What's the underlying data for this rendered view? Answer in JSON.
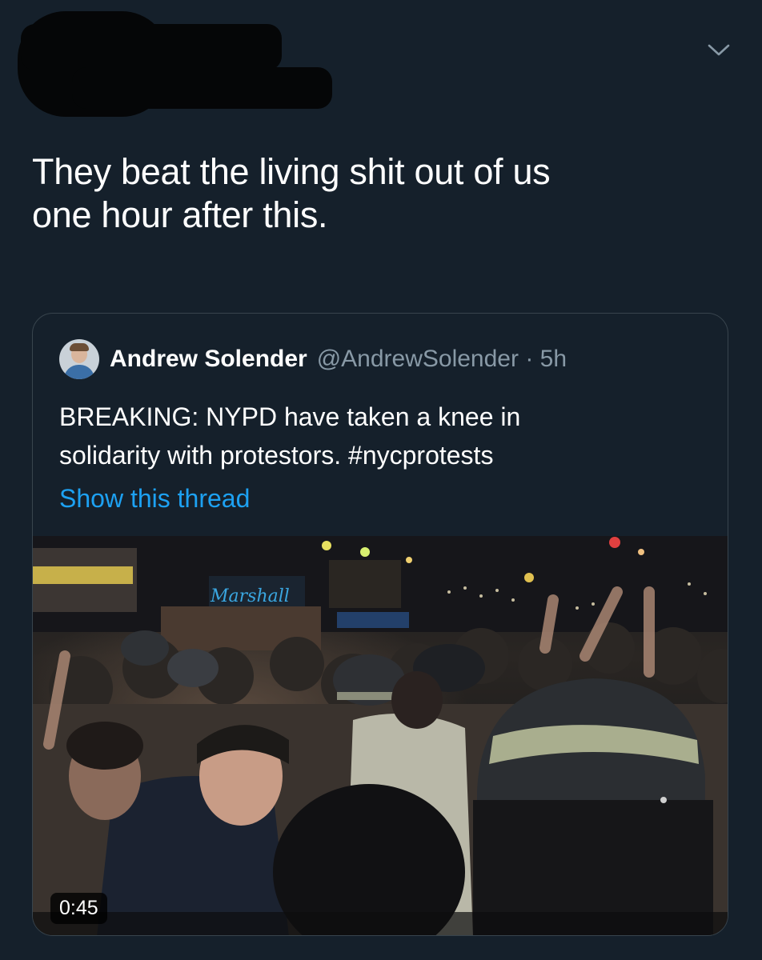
{
  "tweet": {
    "text": "They beat the living shit out of us\none hour after this."
  },
  "quoted_tweet": {
    "author_name": "Andrew Solender",
    "handle_time": "@AndrewSolender · 5h",
    "text": "BREAKING: NYPD have taken a knee in\nsolidarity with protestors. #nycprotests",
    "show_thread": "Show this thread",
    "video": {
      "duration": "0:45",
      "store_sign": "Marshall"
    }
  },
  "icons": {
    "menu": "chevron-down-icon"
  },
  "colors": {
    "background": "#15202b",
    "text": "#ffffff",
    "secondary": "#8899a6",
    "link": "#1da1f2",
    "border": "#38444d"
  }
}
